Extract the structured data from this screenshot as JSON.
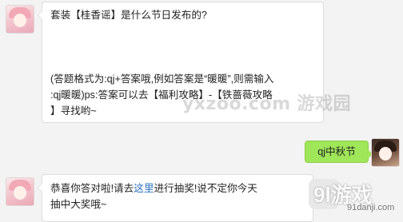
{
  "chat": {
    "msg1": {
      "line1": "套装【桂香谣】是什么节日发布的?",
      "line2": "(答题格式为:qj+答案哦,例如答案是“暖暖”,则需输入",
      "line3": ":qj暖暖)ps:答案可以去【福利攻略】-【铁蔷薇攻略",
      "line4": "】寻找哟~"
    },
    "reply": {
      "text": "qj中秋节"
    },
    "msg2": {
      "pre": "恭喜你答对啦!请去",
      "link": "这里",
      "post": "进行抽奖!说不定你今天",
      "line2": "抽中大奖哦~"
    }
  },
  "watermarks": {
    "center": "yxzoo.com 游戏园",
    "logo_big": "9l游戏",
    "logo_small": "91danji.com"
  }
}
